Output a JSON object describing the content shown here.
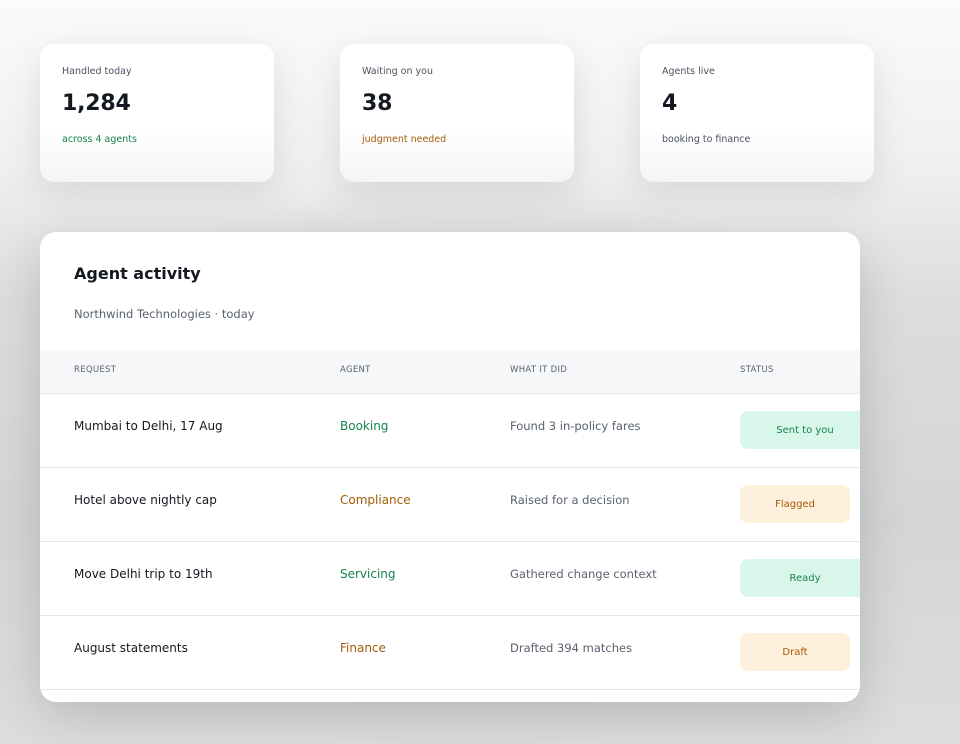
{
  "stats": [
    {
      "label": "Handled today",
      "value": "1,284",
      "sub": "across 4 agents",
      "sub_tone": "green"
    },
    {
      "label": "Waiting on you",
      "value": "38",
      "sub": "judgment needed",
      "sub_tone": "amber"
    },
    {
      "label": "Agents live",
      "value": "4",
      "sub": "booking to finance",
      "sub_tone": "gray"
    }
  ],
  "activity": {
    "title": "Agent activity",
    "subtitle": "Northwind Technologies · today",
    "columns": [
      "REQUEST",
      "AGENT",
      "WHAT IT DID",
      "STATUS"
    ],
    "rows": [
      {
        "request": "Mumbai to Delhi, 17 Aug",
        "agent": "Booking",
        "did": "Found 3 in-policy fares",
        "status": "Sent to you"
      },
      {
        "request": "Hotel above nightly cap",
        "agent": "Compliance",
        "did": "Raised for a decision",
        "status": "Flagged"
      },
      {
        "request": "Move Delhi trip to 19th",
        "agent": "Servicing",
        "did": "Gathered change context",
        "status": "Ready"
      },
      {
        "request": "August statements",
        "agent": "Finance",
        "did": "Drafted 394 matches",
        "status": "Draft"
      }
    ]
  },
  "colors": {
    "green": "#16834f",
    "amber": "#a35c09",
    "green_bg": "#d9f6ea",
    "amber_bg": "#fdf0dc"
  }
}
